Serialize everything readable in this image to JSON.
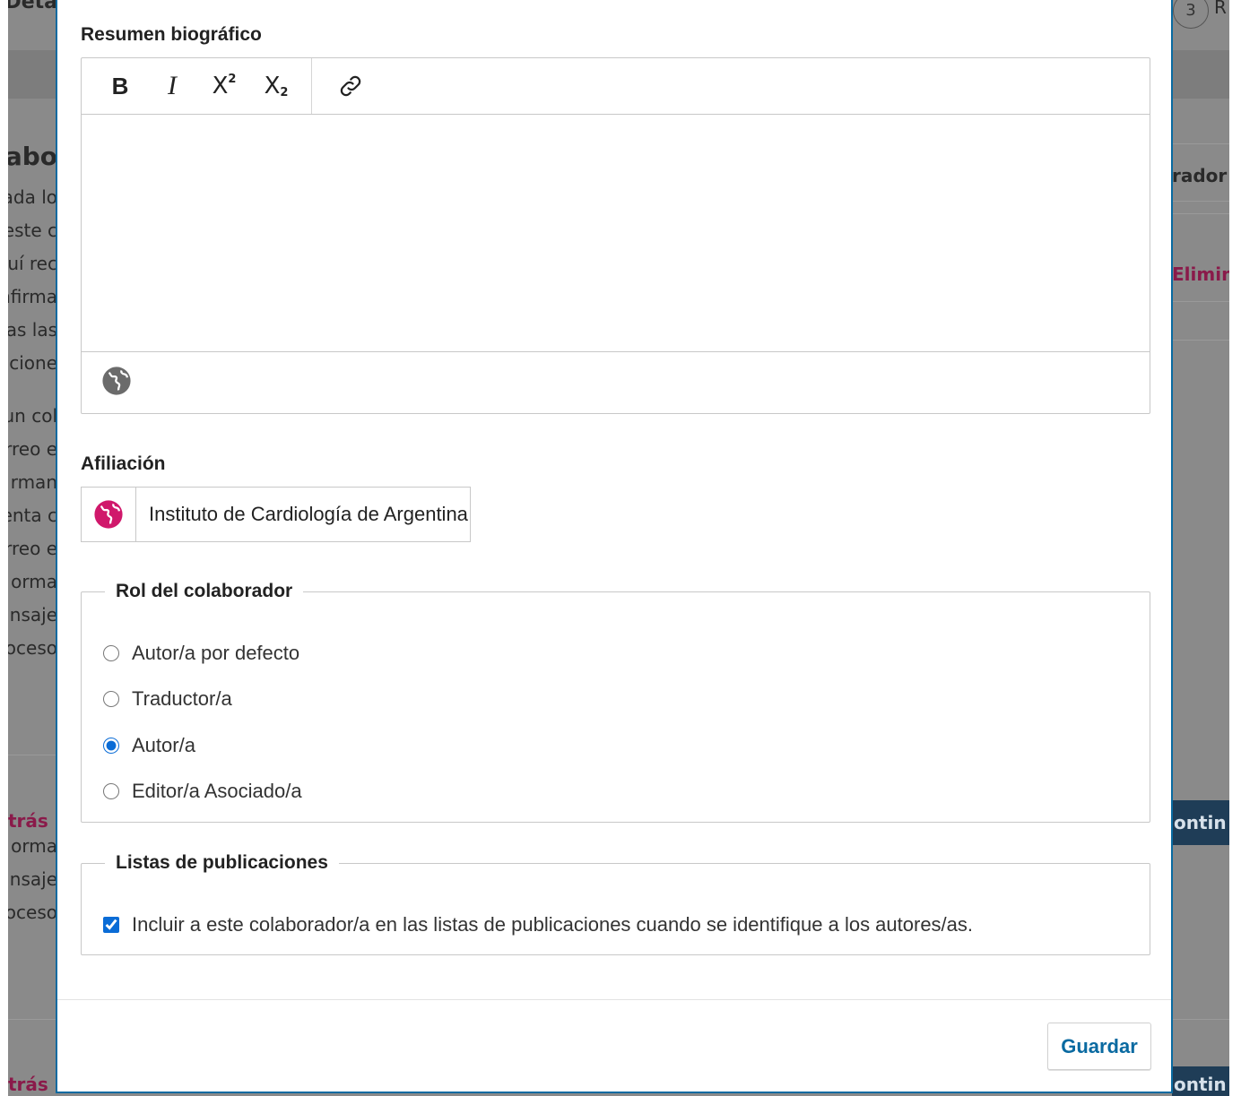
{
  "background": {
    "top_fragment": "Deta",
    "heading_fragment": "olabo",
    "left_lines": [
      "ada lo",
      "este c",
      "uí rec",
      "nfirma",
      "las las",
      "acione",
      "un col",
      "rreo e",
      "rman",
      "enta c",
      "rreo e",
      "orma",
      "nsaje",
      "oceso"
    ],
    "left_lines_b": [
      "orma",
      "nsaje",
      "oceso"
    ],
    "back_link": "trás",
    "back_link_2": "trás",
    "right_colab": "rador",
    "right_delete": "Elimin",
    "right_continue": "ontin",
    "right_continue_2": "ontin",
    "stage_circle": "3",
    "stage_label": "R"
  },
  "modal": {
    "bio": {
      "label": "Resumen biográfico",
      "toolbar": {
        "bold": "B",
        "italic": "I",
        "superscript_base": "X",
        "superscript_mark": "2",
        "subscript_base": "X",
        "subscript_mark": "2"
      },
      "value": ""
    },
    "affiliation": {
      "label": "Afiliación",
      "value": "Instituto de Cardiología de Argentina"
    },
    "role": {
      "legend": "Rol del colaborador",
      "options": [
        {
          "label": "Autor/a por defecto",
          "checked": false
        },
        {
          "label": "Traductor/a",
          "checked": false
        },
        {
          "label": "Autor/a",
          "checked": true
        },
        {
          "label": "Editor/a Asociado/a",
          "checked": false
        }
      ]
    },
    "lists": {
      "legend": "Listas de publicaciones",
      "checkbox_label": "Incluir a este colaborador/a en las listas de publicaciones cuando se identifique a los autores/as.",
      "checked": true
    },
    "save_label": "Guardar"
  },
  "colors": {
    "accent": "#0a6aa1",
    "globe_active": "#d0186b",
    "globe_inactive": "#6b6b6b",
    "radio_check": "#0a6cd6"
  }
}
